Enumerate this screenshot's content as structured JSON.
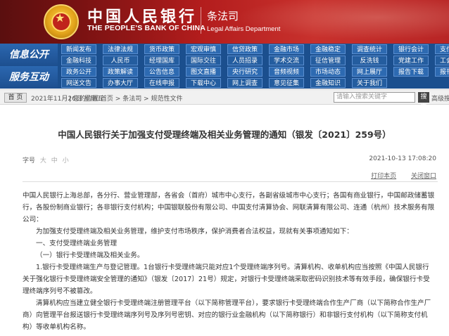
{
  "header": {
    "bank_cn": "中国人民银行",
    "bank_en": "THE PEOPLE'S BANK OF CHINA",
    "dept_cn": "条法司",
    "dept_en": "Legal Affairs Department"
  },
  "nav": {
    "label_info": "信息公开",
    "label_service": "服务互动",
    "row1": [
      "新闻发布",
      "法律法规",
      "货币政策",
      "宏观审慎",
      "信贷政策",
      "金融市场",
      "金融稳定",
      "调查统计",
      "银行会计",
      "支付体系"
    ],
    "row2": [
      "金融科技",
      "人民币",
      "经理国库",
      "国际交往",
      "人员招录",
      "学术交流",
      "征信管理",
      "反洗钱",
      "党建工作",
      "工会工作"
    ],
    "row3": [
      "政务公开",
      "政策解读",
      "公告信息",
      "图文直播",
      "央行研究",
      "音频视频",
      "市场动态",
      "网上展厅",
      "报告下载",
      "报刊年鉴"
    ],
    "row4": [
      "网送文告",
      "办事大厅",
      "在线申报",
      "下载中心",
      "网上调查",
      "意见征集",
      "金融知识",
      "关于我们"
    ]
  },
  "crumb": {
    "home_button": "首 页",
    "date": "2021年11月26日 星期五",
    "location": "| 您的位置:首页  >  条法司  >  规范性文件",
    "search_placeholder": "请输入搜索关键字",
    "search_button": "搜索",
    "advanced": "高级搜索"
  },
  "article": {
    "title": "中国人民银行关于加强支付受理终端及相关业务管理的通知（银发〔2021〕259号）",
    "font_size_label": "字号",
    "font_large": "大",
    "font_medium": "中",
    "font_small": "小",
    "pub_date": "2021-10-13 17:08:20",
    "print": "打印本页",
    "close": "关闭窗口",
    "paragraphs": [
      "中国人民银行上海总部，各分行、营业管理部，各省会（首府）城市中心支行，各副省级城市中心支行；各国有商业银行，中国邮政储蓄银行，各股份制商业银行；各非银行支付机构；中国银联股份有限公司、中国支付清算协会、网联清算有限公司、连通（杭州）技术服务有限公司：",
      "为加强支付受理终端及相关业务管理，维护支付市场秩序，保护消费者合法权益，现就有关事项通知如下：",
      "一、支付受理终端业务管理",
      "（一）银行卡受理终端及相关业务。",
      "1.银行卡受理终端生产与登记管理。1台银行卡受理终端只能对应1个受理终端序列号。清算机构、收单机构应当按照《中国人民银行关于强化银行卡受理终端安全管理的通知》（银发〔2017〕21号）规定，对银行卡受理终端采取密码识别技术等有效手段，确保银行卡受理终端序列号不被篡改。",
      "清算机构应当建立健全银行卡受理终端注册管理平台（以下简称管理平台），要求银行卡受理终端合作生产厂商（以下简称合作生产厂商）向管理平台报送银行卡受理终端序列号及序列号密钥、对应的银行业金融机构（以下简称银行）和非银行支付机构（以下简称支付机构）等收单机构名称。"
    ]
  },
  "colors": {
    "banner_red": "#b31d1d",
    "nav_blue": "#1b4f8e",
    "nav_button": "#2d6ab1"
  }
}
